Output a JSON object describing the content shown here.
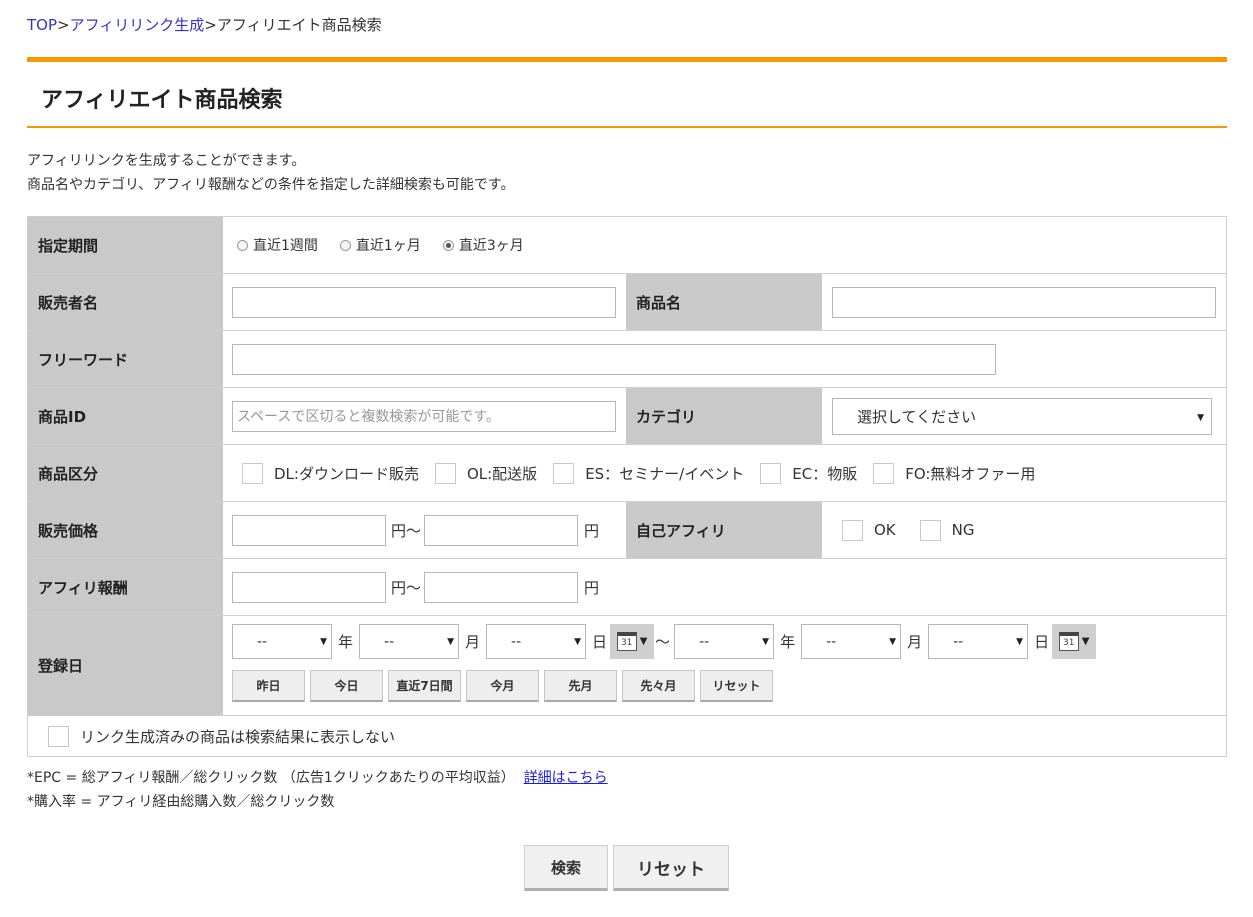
{
  "breadcrumb": {
    "top": "TOP",
    "sep1": ">",
    "link": "アフィリリンク生成",
    "sep2": ">",
    "current": "アフィリエイト商品検索"
  },
  "page_title": "アフィリエイト商品検索",
  "description": {
    "line1": "アフィリリンクを生成することができます。",
    "line2": "商品名やカテゴリ、アフィリ報酬などの条件を指定した詳細検索も可能です。"
  },
  "form": {
    "period": {
      "label": "指定期間",
      "options": [
        "直近1週間",
        "直近1ヶ月",
        "直近3ヶ月"
      ],
      "selected": "直近3ヶ月"
    },
    "seller": {
      "label": "販売者名",
      "value": ""
    },
    "product_name": {
      "label": "商品名",
      "value": ""
    },
    "freeword": {
      "label": "フリーワード",
      "value": ""
    },
    "product_id": {
      "label": "商品ID",
      "placeholder": "スペースで区切ると複数検索が可能です。"
    },
    "category": {
      "label": "カテゴリ",
      "selected": "選択してください"
    },
    "product_type": {
      "label": "商品区分",
      "options": [
        "DL:ダウンロード販売",
        "OL:配送版",
        "ES：セミナー/イベント",
        "EC：物販",
        "FO:無料オファー用"
      ]
    },
    "price": {
      "label": "販売価格",
      "unit1": "円〜",
      "unit2": "円"
    },
    "self_affiliate": {
      "label": "自己アフィリ",
      "options": [
        "OK",
        "NG"
      ]
    },
    "reward": {
      "label": "アフィリ報酬",
      "unit1": "円〜",
      "unit2": "円"
    },
    "reg_date": {
      "label": "登録日",
      "select_placeholder": "--",
      "year": "年",
      "month": "月",
      "day": "日",
      "tilde": "〜",
      "calendar_day": "31",
      "quick_buttons": [
        "昨日",
        "今日",
        "直近7日間",
        "今月",
        "先月",
        "先々月",
        "リセット"
      ]
    },
    "hide_generated": "リンク生成済みの商品は検索結果に表示しない"
  },
  "notes": {
    "epc": "*EPC = 総アフィリ報酬／総クリック数 （広告1クリックあたりの平均収益）",
    "epc_link": "詳細はこちら",
    "purchase_rate": "*購入率 = アフィリ経由総購入数／総クリック数"
  },
  "buttons": {
    "search": "検索",
    "reset": "リセット"
  }
}
